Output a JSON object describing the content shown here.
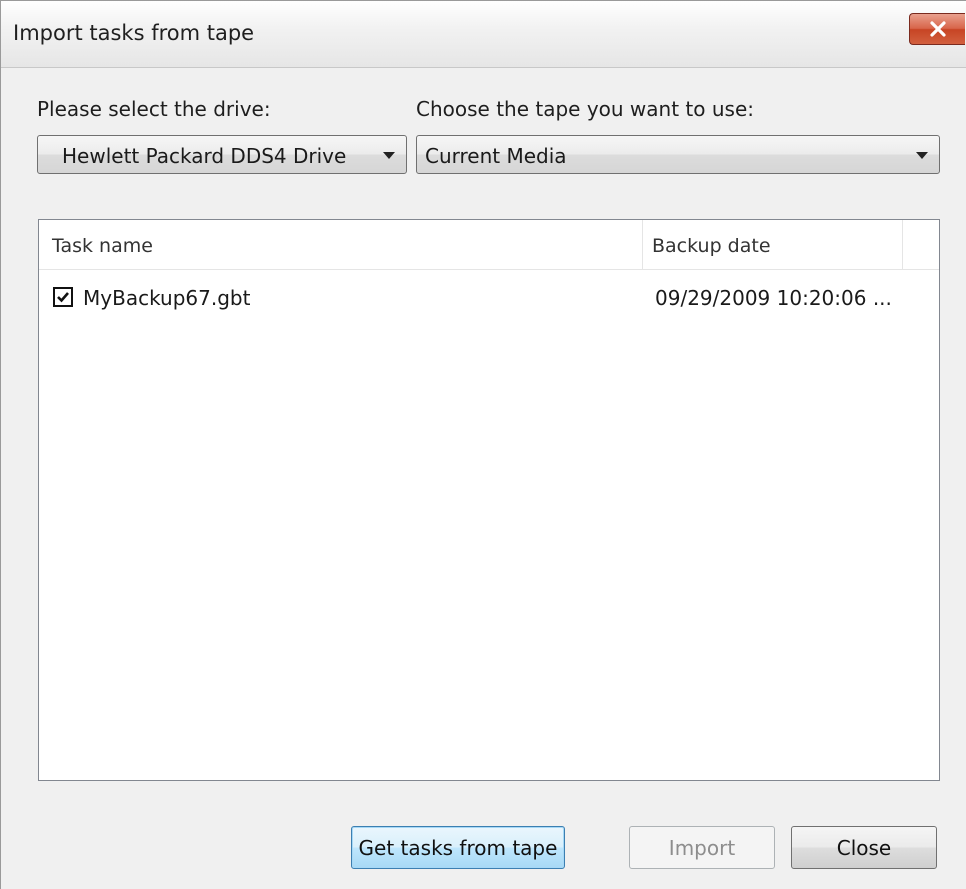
{
  "window": {
    "title": "Import tasks from tape"
  },
  "drive": {
    "label": "Please select the drive:",
    "selected": "Hewlett Packard DDS4 Drive"
  },
  "tape": {
    "label": "Choose the tape you want to use:",
    "selected": "Current Media"
  },
  "task_list": {
    "columns": [
      "Task name",
      "Backup date"
    ],
    "rows": [
      {
        "checked": true,
        "task_name": "MyBackup67.gbt",
        "backup_date": "09/29/2009 10:20:06 ..."
      }
    ]
  },
  "buttons": {
    "get_tasks": "Get tasks from tape",
    "import": "Import",
    "close": "Close"
  },
  "icons": {
    "close": "close-icon",
    "dropdown": "chevron-down-icon",
    "check": "checkmark-icon"
  },
  "colors": {
    "close_button": "#c74424",
    "default_button_border": "#3c7fb1",
    "window_background": "#f0f0f0"
  }
}
